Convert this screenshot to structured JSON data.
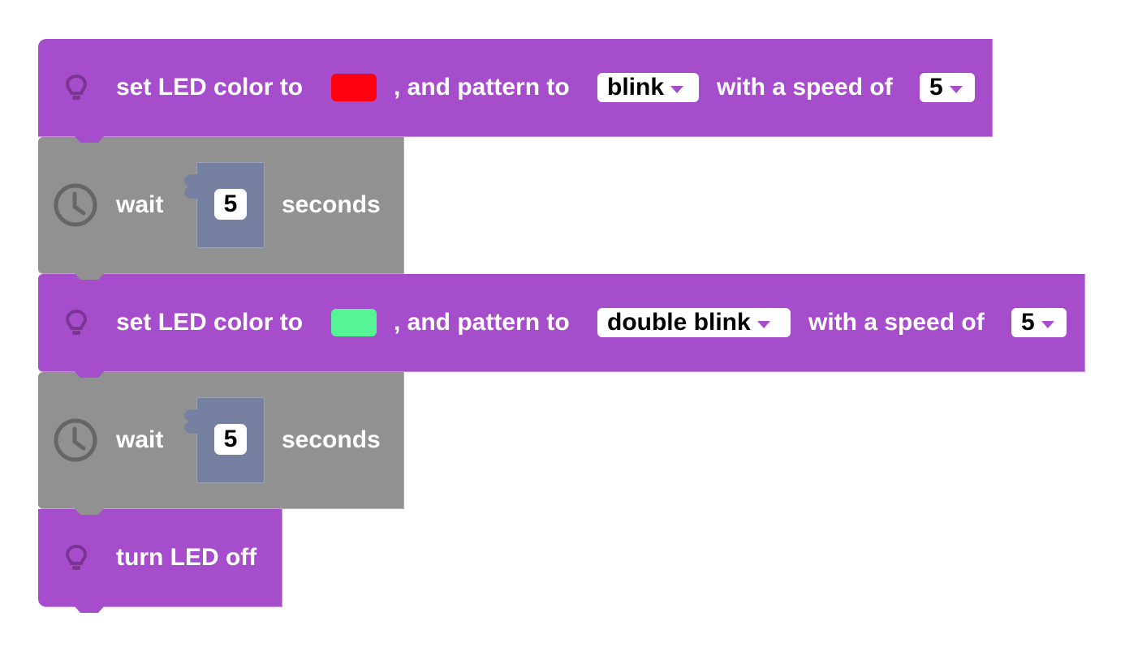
{
  "colors": {
    "looks_block": "#a64dcc",
    "control_block": "#919191",
    "input_slot": "#7680a0",
    "led_color_1": "#ff0010",
    "led_color_2": "#55f595"
  },
  "blocks": [
    {
      "type": "set_led",
      "icon": "lightbulb-icon",
      "label_prefix": "set LED color to",
      "label_pattern": ", and pattern to",
      "pattern": "blink",
      "label_speed": "with a speed of",
      "speed": "5"
    },
    {
      "type": "wait",
      "icon": "clock-icon",
      "label_wait": "wait",
      "value": "5",
      "label_unit": "seconds"
    },
    {
      "type": "set_led",
      "icon": "lightbulb-icon",
      "label_prefix": "set LED color to",
      "label_pattern": ", and pattern to",
      "pattern": "double blink",
      "label_speed": "with a speed of",
      "speed": "5"
    },
    {
      "type": "wait",
      "icon": "clock-icon",
      "label_wait": "wait",
      "value": "5",
      "label_unit": "seconds"
    },
    {
      "type": "led_off",
      "icon": "lightbulb-icon",
      "label": "turn LED off"
    }
  ]
}
